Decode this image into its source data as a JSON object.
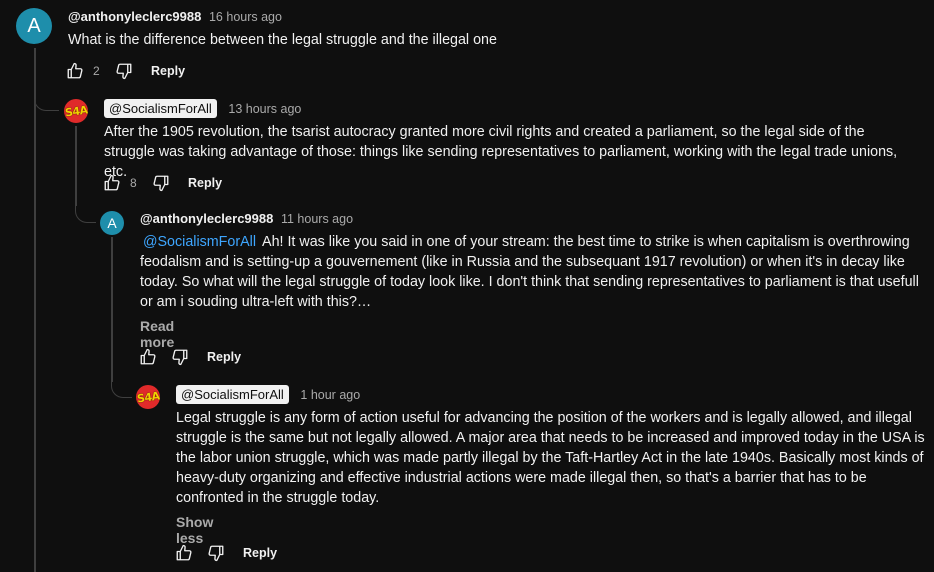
{
  "comments": [
    {
      "author": "@anthonyleclerc9988",
      "avatar_letter": "A",
      "time": "16 hours ago",
      "text": "What is the difference between the legal struggle and the illegal one",
      "likes": "2",
      "reply_label": "Reply"
    },
    {
      "author": "@SocialismForAll",
      "avatar_text": "S4A",
      "time": "13 hours ago",
      "text": "After the 1905 revolution, the tsarist autocracy granted more civil rights and created a parliament, so the legal side of the struggle was taking advantage of those: things like sending representatives to parliament, working with the legal trade unions, etc.",
      "likes": "8",
      "reply_label": "Reply"
    },
    {
      "author": "@anthonyleclerc9988",
      "avatar_letter": "A",
      "time": "11 hours ago",
      "mention": "@SocialismForAll",
      "text": "Ah! It was like you said in one of your stream: the best time to strike is when capitalism is overthrowing feodalism and is setting-up a gouvernement (like in Russia and the subsequant 1917 revolution) or when it's in decay like today. So what will the legal struggle of today look like. I don't think that sending representatives to parliament is that usefull or am i souding ultra-left with this?…",
      "more_label": "Read more",
      "reply_label": "Reply"
    },
    {
      "author": "@SocialismForAll",
      "avatar_text": "S4A",
      "time": "1 hour ago",
      "text": "Legal struggle is any form of action useful for advancing the position of the workers and is legally allowed, and illegal struggle is the same but not legally allowed. A major area that needs to be increased and improved today in the USA is the labor union struggle, which was made partly illegal by the Taft-Hartley Act in the late 1940s. Basically most kinds of heavy-duty organizing and effective industrial actions were made illegal then, so that's a barrier that has to be confronted in the struggle today.",
      "more_label": "Show less",
      "reply_label": "Reply"
    }
  ],
  "icons": {
    "like": "thumb-up-icon",
    "dislike": "thumb-down-icon"
  },
  "colors": {
    "background": "#0f0f0f",
    "mention": "#3ea6ff",
    "avatar_letter_bg": "#1e8eab",
    "channel_avatar_bg": "#e02a2a"
  }
}
